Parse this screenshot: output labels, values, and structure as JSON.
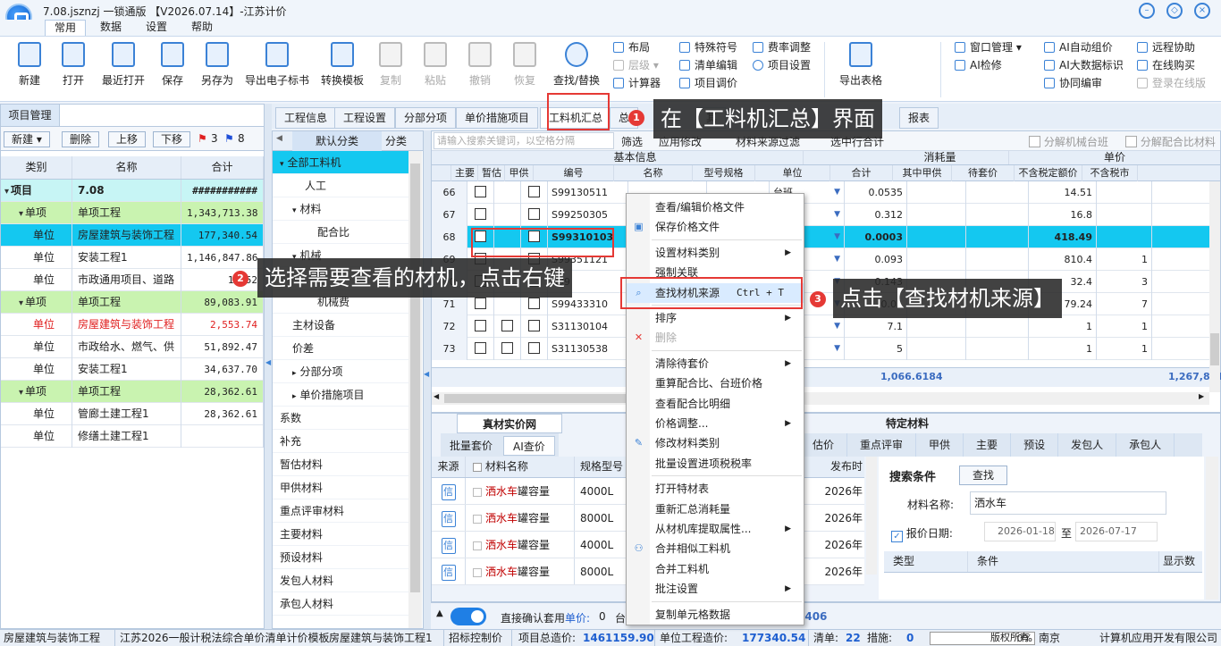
{
  "window": {
    "title": "7.08.jsznzj  一锁通版 【V2026.07.14】-江苏计价"
  },
  "menu": [
    "常用",
    "数据",
    "设置",
    "帮助"
  ],
  "ribbon": {
    "big": [
      {
        "label": "新建",
        "icon": "new-file-icon",
        "enabled": true
      },
      {
        "label": "打开",
        "icon": "folder-open-icon",
        "enabled": true
      },
      {
        "label": "最近打开",
        "icon": "recent-file-icon",
        "enabled": true
      },
      {
        "label": "保存",
        "icon": "save-icon",
        "enabled": true
      },
      {
        "label": "另存为",
        "icon": "save-as-icon",
        "enabled": true
      },
      {
        "label": "导出电子标书",
        "icon": "export-bid-icon",
        "enabled": true
      },
      {
        "label": "转换模板",
        "icon": "convert-template-icon",
        "enabled": true
      },
      {
        "label": "复制",
        "icon": "copy-icon",
        "enabled": false
      },
      {
        "label": "粘贴",
        "icon": "paste-icon",
        "enabled": false
      },
      {
        "label": "撤销",
        "icon": "undo-icon",
        "enabled": false
      },
      {
        "label": "恢复",
        "icon": "redo-icon",
        "enabled": false
      },
      {
        "label": "查找/替换",
        "icon": "search-icon",
        "enabled": true
      }
    ],
    "small_col1": [
      {
        "label": "布局",
        "enabled": true
      },
      {
        "label": "层级",
        "enabled": false
      },
      {
        "label": "计算器",
        "enabled": true
      }
    ],
    "small_col2": [
      {
        "label": "特殊符号",
        "enabled": true
      },
      {
        "label": "清单编辑",
        "enabled": true
      },
      {
        "label": "项目调价",
        "enabled": true
      }
    ],
    "small_col3": [
      {
        "label": "费率调整",
        "enabled": true
      },
      {
        "label": "项目设置",
        "enabled": true
      }
    ],
    "export_table": "导出表格",
    "small_col4": [
      {
        "label": "窗口管理",
        "enabled": true
      },
      {
        "label": "AI检修",
        "enabled": true
      }
    ],
    "small_col5": [
      {
        "label": "AI自动组价",
        "enabled": true
      },
      {
        "label": "AI大数据标识",
        "enabled": true
      },
      {
        "label": "协同编审",
        "enabled": true
      }
    ],
    "small_col6": [
      {
        "label": "远程协助",
        "enabled": true
      },
      {
        "label": "在线购买",
        "enabled": true
      },
      {
        "label": "登录在线版",
        "enabled": false
      }
    ]
  },
  "left_panel": {
    "title": "项目管理",
    "buttons": [
      "新建",
      "删除",
      "上移",
      "下移"
    ],
    "flags": [
      {
        "color": "#e02020",
        "count": "3"
      },
      {
        "color": "#1f4fd8",
        "count": "8"
      }
    ],
    "headers": [
      "类别",
      "名称",
      "合计"
    ],
    "rows": [
      {
        "type": "项目",
        "name": "7.08",
        "total": "###########",
        "level": 0,
        "bg": "#c7f5f5",
        "bold": true
      },
      {
        "type": "单项",
        "name": "单项工程",
        "total": "1,343,713.38",
        "level": 1,
        "bg": "#c9f3b0"
      },
      {
        "type": "单位",
        "name": "房屋建筑与装饰工程",
        "total": "177,340.54",
        "level": 2,
        "bg": "#14c8f0"
      },
      {
        "type": "单位",
        "name": "安装工程1",
        "total": "1,146,847.86",
        "level": 2,
        "bg": "#ffffff"
      },
      {
        "type": "单位",
        "name": "市政通用项目、道路",
        "total": "19,52",
        "level": 2,
        "bg": "#ffffff"
      },
      {
        "type": "单项",
        "name": "单项工程",
        "total": "89,083.91",
        "level": 1,
        "bg": "#c9f3b0"
      },
      {
        "type": "单位",
        "name": "房屋建筑与装饰工程",
        "total": "2,553.74",
        "level": 2,
        "bg": "#ffffff",
        "red": true
      },
      {
        "type": "单位",
        "name": "市政给水、燃气、供",
        "total": "51,892.47",
        "level": 2,
        "bg": "#ffffff"
      },
      {
        "type": "单位",
        "name": "安装工程1",
        "total": "34,637.70",
        "level": 2,
        "bg": "#ffffff"
      },
      {
        "type": "单项",
        "name": "单项工程",
        "total": "28,362.61",
        "level": 1,
        "bg": "#c9f3b0"
      },
      {
        "type": "单位",
        "name": "管廊土建工程1",
        "total": "28,362.61",
        "level": 2,
        "bg": "#ffffff"
      },
      {
        "type": "单位",
        "name": "修缮土建工程1",
        "total": "",
        "level": 2,
        "bg": "#ffffff"
      }
    ]
  },
  "center_tabs": [
    "工程信息",
    "工程设置",
    "分部分项",
    "单价措施项目",
    "工料机汇总",
    "总",
    "其",
    "报表"
  ],
  "tree": {
    "tabs": [
      "默认分类",
      "分类"
    ],
    "items": [
      {
        "label": "全部工料机",
        "indent": 0,
        "selected": true,
        "exp": "▾"
      },
      {
        "label": "人工",
        "indent": 2
      },
      {
        "label": "材料",
        "indent": 1,
        "exp": "▾"
      },
      {
        "label": "配合比",
        "indent": 3
      },
      {
        "label": "机械",
        "indent": 1,
        "exp": "▾"
      },
      {
        "label": "",
        "indent": 3
      },
      {
        "label": "机械费",
        "indent": 3
      },
      {
        "label": "主材设备",
        "indent": 1
      },
      {
        "label": "价差",
        "indent": 1
      },
      {
        "label": "分部分项",
        "indent": 1,
        "exp": "▸"
      },
      {
        "label": "单价措施项目",
        "indent": 1,
        "exp": "▸"
      },
      {
        "label": "系数",
        "indent": 0
      },
      {
        "label": "补充",
        "indent": 0
      },
      {
        "label": "暂估材料",
        "indent": 0
      },
      {
        "label": "甲供材料",
        "indent": 0
      },
      {
        "label": "重点评审材料",
        "indent": 0
      },
      {
        "label": "主要材料",
        "indent": 0
      },
      {
        "label": "预设材料",
        "indent": 0
      },
      {
        "label": "发包人材料",
        "indent": 0
      },
      {
        "label": "承包人材料",
        "indent": 0
      }
    ]
  },
  "grid": {
    "search_placeholder": "请输入搜索关键词，以空格分隔",
    "filter_btn": "筛选",
    "apply_mod": "应用修改",
    "source_filter": "材料来源过滤",
    "select_total": "选中行合计",
    "split_machine": "分解机械台班",
    "split_mix": "分解配合比材料",
    "group_headers": [
      "基本信息",
      "消耗量",
      "单价"
    ],
    "headers": [
      "主要",
      "暂估",
      "甲供",
      "编号",
      "名称",
      "型号规格",
      "单位",
      "合计",
      "其中甲供",
      "待套价",
      "不含税定额价",
      "不含税市"
    ],
    "rows": [
      {
        "no": "66",
        "code": "S99130511",
        "unit": "台班",
        "qty": "0.0535",
        "price": "14.51"
      },
      {
        "no": "67",
        "code": "S99250305",
        "unit": "台班",
        "qty": "0.312",
        "price": "16.8"
      },
      {
        "no": "68",
        "code": "S99310103",
        "spec": "0L",
        "unit": "台班",
        "qty": "0.0003",
        "price": "418.49",
        "selected": true
      },
      {
        "no": "69",
        "code": "S99351121",
        "spec": "以内",
        "unit": "台班",
        "qty": "0.093",
        "price": "810.4",
        "extra": "1"
      },
      {
        "no": "70",
        "code": "S99",
        "spec": "0mm",
        "unit": "台班",
        "qty": "0.143",
        "price": "32.4",
        "extra": "3"
      },
      {
        "no": "71",
        "code": "S99433310",
        "unit": "台班",
        "qty": "0.01",
        "price": "79.24",
        "extra": "7"
      },
      {
        "no": "72",
        "code": "S31130104",
        "unit": "%",
        "qty": "7.1",
        "price": "1",
        "extra": "1"
      },
      {
        "no": "73",
        "code": "S31130538",
        "unit": "%",
        "qty": "5",
        "price": "1",
        "extra": "1"
      }
    ],
    "footer_total": "1,066.6184",
    "footer_total2": "1,267,831"
  },
  "lower": {
    "left_title": "真材实价网",
    "left_tabs": [
      "批量套价",
      "AI查价"
    ],
    "headers": [
      "来源",
      "材料名称",
      "规格型号",
      "发布时"
    ],
    "source_badge": "信",
    "items": [
      {
        "name_hl": "洒水车",
        "name_rest": "罐容量",
        "spec": "4000L",
        "date": "2026年"
      },
      {
        "name_hl": "洒水车",
        "name_rest": "罐容量",
        "spec": "8000L",
        "date": "2026年"
      },
      {
        "name_hl": "洒水车",
        "name_rest": "罐容量",
        "spec": "4000L",
        "date": "2026年"
      },
      {
        "name_hl": "洒水车",
        "name_rest": "罐容量",
        "spec": "8000L",
        "date": "2026年"
      }
    ],
    "right_title": "特定材料",
    "right_tabs": [
      "估价",
      "重点评审",
      "甲供",
      "主要",
      "预设",
      "发包人",
      "承包人"
    ],
    "search_title": "搜索条件",
    "search_btn": "查找",
    "material_label": "材料名称:",
    "material_value": "洒水车",
    "date_label": "报价日期:",
    "date_from": "2026-01-18",
    "date_to_sep": "至",
    "date_to": "2026-07-17",
    "cond_headers": [
      "类型",
      "条件",
      "显示数"
    ],
    "bottom_text": "直接确认套用",
    "unit_price_label": "单价:",
    "unit_price_value": "0",
    "bottom_extra": "台",
    "bottom_num": "3406"
  },
  "context_menu": {
    "items": [
      {
        "label": "查看/编辑价格文件"
      },
      {
        "label": "保存价格文件",
        "icon": "save-icon"
      },
      {
        "sep": true
      },
      {
        "label": "设置材料类别",
        "arrow": true
      },
      {
        "label": "强制关联"
      },
      {
        "label": "查找材机来源",
        "shortcut": "Ctrl + T",
        "icon": "search-icon",
        "highlight": true
      },
      {
        "sep": true
      },
      {
        "label": "排序",
        "arrow": true
      },
      {
        "label": "删除",
        "disabled": true,
        "icon": "delete-icon"
      },
      {
        "sep": true
      },
      {
        "label": "清除待套价",
        "arrow": true
      },
      {
        "label": "重算配合比、台班价格"
      },
      {
        "label": "查看配合比明细"
      },
      {
        "label": "价格调整...",
        "arrow": true
      },
      {
        "label": "修改材料类别",
        "icon": "edit-icon"
      },
      {
        "label": "批量设置进项税税率"
      },
      {
        "sep": true
      },
      {
        "label": "打开特材表"
      },
      {
        "label": "重新汇总消耗量"
      },
      {
        "label": "从材机库提取属性...",
        "arrow": true
      },
      {
        "label": "合并相似工料机",
        "icon": "merge-icon"
      },
      {
        "label": "合并工料机"
      },
      {
        "label": "批注设置",
        "arrow": true
      },
      {
        "sep": true
      },
      {
        "label": "复制单元格数据"
      }
    ]
  },
  "callouts": [
    {
      "n": "1",
      "text": "在【工料机汇总】界面"
    },
    {
      "n": "2",
      "text": "选择需要查看的材机，点击右键"
    },
    {
      "n": "3",
      "text": "点击【查找材机来源】"
    }
  ],
  "status": {
    "items": [
      "房屋建筑与装饰工程",
      "江苏2026一般计税法综合单价清单计价模板",
      "房屋建筑与装饰工程1",
      "招标控制价"
    ],
    "total_label": "项目总造价:",
    "total_value": "1461159.90",
    "unit_label": "单位工程造价:",
    "unit_value": "177340.54",
    "list_label": "清单:",
    "list_value": "22",
    "measure_label": "措施:",
    "measure_value": "0",
    "progress": "0%",
    "copyright": "版权所有",
    "company": "南京",
    "company2": "计算机应用开发有限公司"
  }
}
